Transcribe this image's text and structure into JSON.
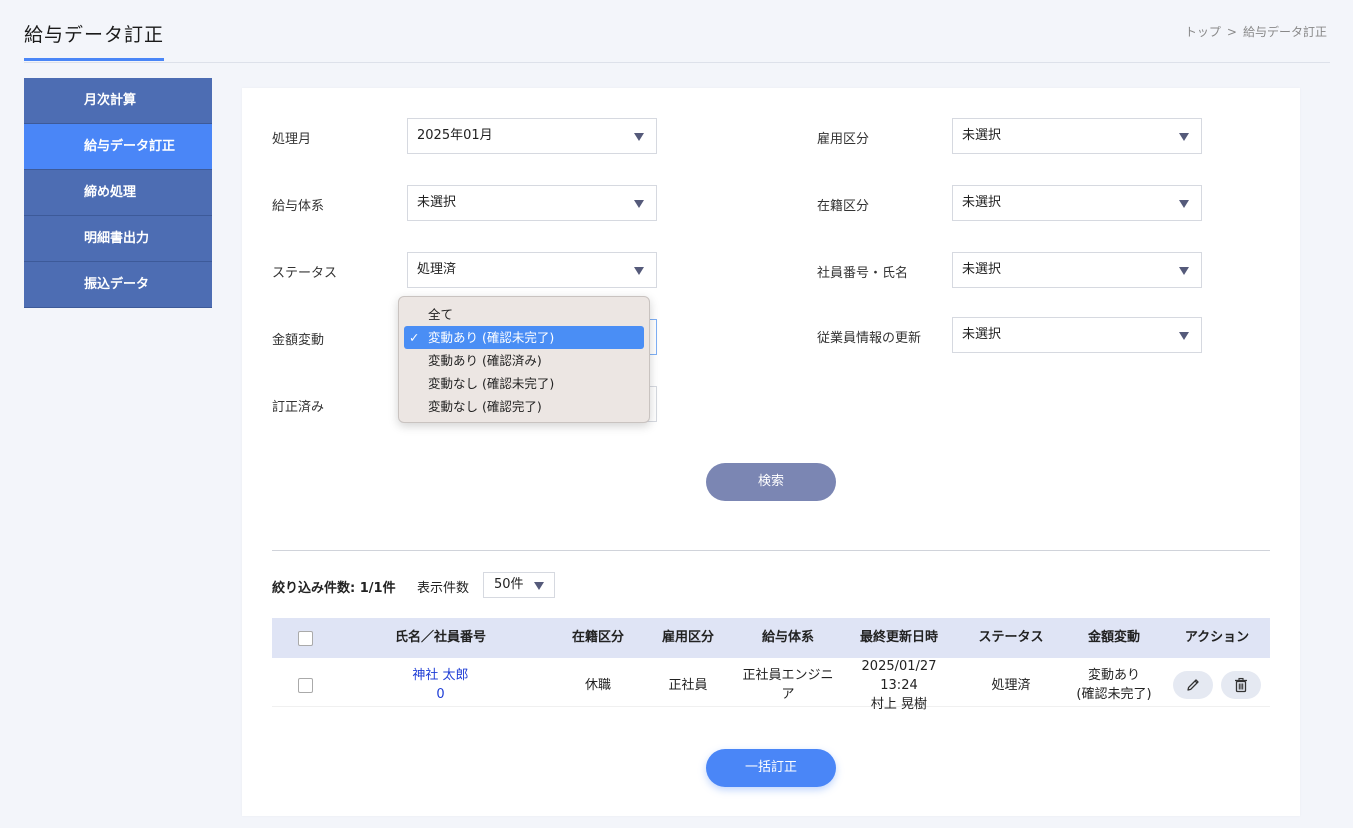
{
  "header": {
    "title": "給与データ訂正",
    "breadcrumb": [
      "トップ",
      ">",
      "給与データ訂正"
    ]
  },
  "sidebar": {
    "items": [
      {
        "label": "月次計算"
      },
      {
        "label": "給与データ訂正",
        "active": true
      },
      {
        "label": "締め処理"
      },
      {
        "label": "明細書出力"
      },
      {
        "label": "振込データ"
      }
    ]
  },
  "filters": {
    "processing_month": {
      "label": "処理月",
      "value": "2025年01月"
    },
    "salary_system": {
      "label": "給与体系",
      "value": "未選択"
    },
    "status": {
      "label": "ステータス",
      "value": "処理済"
    },
    "amount_change": {
      "label": "金額変動"
    },
    "corrected": {
      "label": "訂正済み"
    },
    "employment_type": {
      "label": "雇用区分",
      "value": "未選択"
    },
    "enrollment_type": {
      "label": "在籍区分",
      "value": "未選択"
    },
    "employee": {
      "label": "社員番号・氏名",
      "value": "未選択"
    },
    "employee_info_update": {
      "label": "従業員情報の更新",
      "value": "未選択"
    }
  },
  "dropdown": {
    "check": "✓",
    "options": [
      {
        "label": "全て"
      },
      {
        "label": "変動あり (確認未完了)",
        "selected": true
      },
      {
        "label": "変動あり (確認済み)"
      },
      {
        "label": "変動なし (確認未完了)"
      },
      {
        "label": "変動なし (確認完了)"
      }
    ]
  },
  "search_button": "検索",
  "results": {
    "count_label": "絞り込み件数: 1/1件",
    "per_page_label": "表示件数",
    "per_page_value": "50件"
  },
  "table": {
    "headers": [
      "氏名／社員番号",
      "在籍区分",
      "雇用区分",
      "給与体系",
      "最終更新日時",
      "ステータス",
      "金額変動",
      "アクション"
    ],
    "rows": [
      {
        "name": "神社 太郎",
        "employee_number": "0",
        "enrollment": "休職",
        "employment": "正社員",
        "salary_system": "正社員エンジニア",
        "updated_at": "2025/01/27 13:24",
        "updated_by": "村上 晃樹",
        "status": "処理済",
        "amount_change": "変動あり",
        "amount_change_note": "(確認未完了)"
      }
    ],
    "icons": {
      "edit": "pencil-icon",
      "delete": "trash-icon"
    }
  },
  "bulk_button": "一括訂正",
  "colors": {
    "accent": "#4a86f7",
    "sidebar": "#4d6db3",
    "search_button": "#7b86b3",
    "table_header": "#dfe4f5"
  }
}
